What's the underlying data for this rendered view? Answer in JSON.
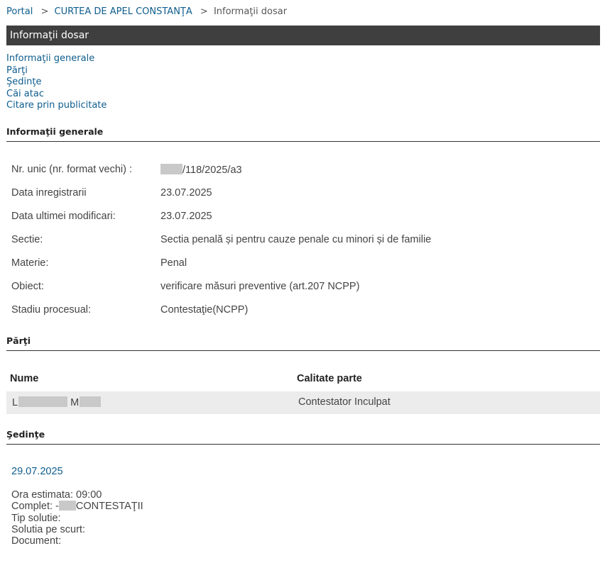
{
  "breadcrumb": {
    "portal": "Portal",
    "separator": ">",
    "court": "CURTEA DE APEL CONSTANŢA",
    "current": "Informaţii dosar"
  },
  "title": "Informaţii dosar",
  "quicknav": [
    "Informaţii generale",
    "Părţi",
    "Şedinţe",
    "Căi atac",
    "Citare prin publicitate"
  ],
  "general": {
    "heading": "Informaţii generale",
    "rows": [
      {
        "label": "Nr. unic (nr. format vechi) :",
        "value": "/118/2025/a3"
      },
      {
        "label": "Data inregistrarii",
        "value": "23.07.2025"
      },
      {
        "label": "Data ultimei modificari:",
        "value": "23.07.2025"
      },
      {
        "label": "Sectie:",
        "value": "Sectia penală și pentru cauze penale cu minori și de familie"
      },
      {
        "label": "Materie:",
        "value": "Penal"
      },
      {
        "label": "Obiect:",
        "value": "verificare măsuri preventive (art.207 NCPP)"
      },
      {
        "label": "Stadiu procesual:",
        "value": "Contestaţie(NCPP)"
      }
    ]
  },
  "parti": {
    "heading": "Părţi",
    "columns": [
      "Nume",
      "Calitate parte"
    ],
    "rows": [
      {
        "name_initial_1": "L",
        "name_initial_2": "M",
        "calitate": "Contestator Inculpat"
      }
    ]
  },
  "sedinte": {
    "heading": "Şedinţe",
    "date": "29.07.2025",
    "ora": "Ora estimata: 09:00",
    "complet_prefix": "Complet: -",
    "complet_suffix": "CONTESTAŢII",
    "tip_solutie": "Tip solutie:",
    "solutia": "Solutia pe scurt:",
    "document": "Document:"
  },
  "colors": {
    "link": "#0f5d8d",
    "title_bar": "#3f3f3f",
    "row_bg": "#ececec",
    "redaction": "#c9c9c9"
  }
}
